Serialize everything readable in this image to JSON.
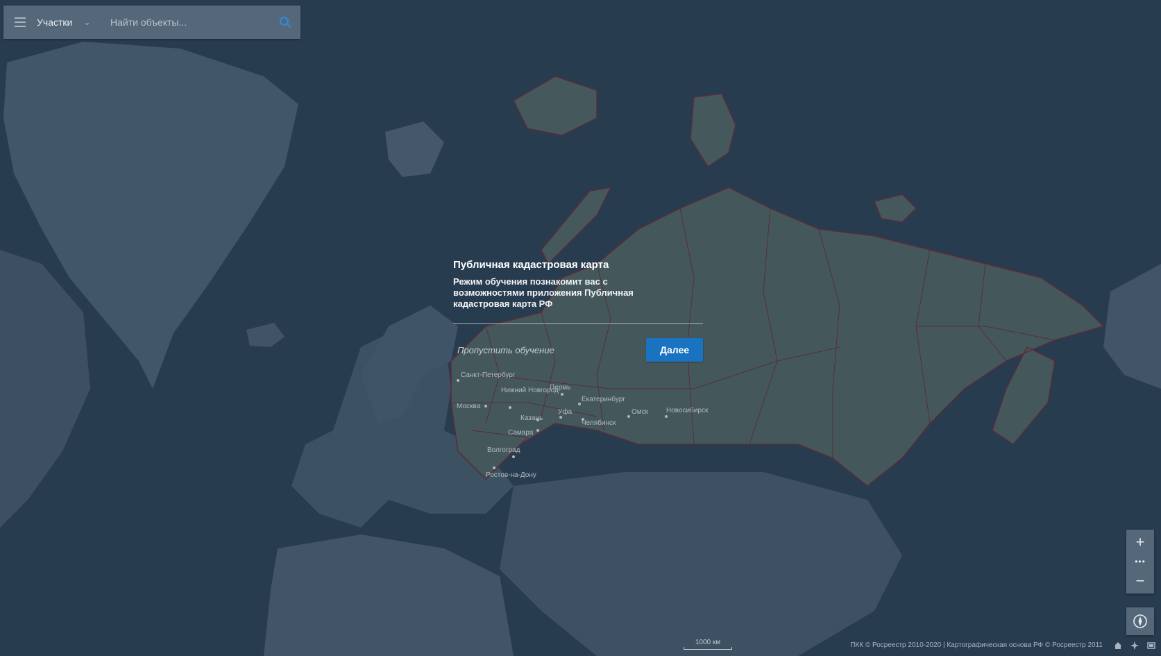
{
  "search": {
    "mode_label": "Участки",
    "placeholder": "Найти объекты..."
  },
  "tutorial": {
    "title": "Публичная кадастровая карта",
    "text": "Режим обучения познакомит вас с возможностями приложения Публичная кадастровая карта РФ",
    "skip_label": "Пропустить обучение",
    "next_label": "Далее"
  },
  "map": {
    "cities": [
      "Санкт-Петербург",
      "Нижний Новгород",
      "Москва",
      "Пермь",
      "Екатеринбург",
      "Уфа",
      "Казань",
      "Самара",
      "Челябинск",
      "Омск",
      "Новосибирск",
      "Волгоград",
      "Ростов-на-Дону"
    ],
    "scale_label": "1000 км",
    "attribution": "ПКК © Росреестр 2010-2020 | Картографическая основа РФ © Росреестр 2011"
  },
  "zoom": {
    "in_label": "+",
    "more_label": "•••",
    "out_label": "−"
  },
  "icons": {
    "menu": "menu-icon",
    "chevron": "chevron-down-icon",
    "search": "search-icon",
    "compass": "compass-icon",
    "home": "home-icon",
    "locate": "locate-icon",
    "layers": "layers-icon"
  },
  "colors": {
    "ocean": "#2e4357",
    "land": "#4a5f70",
    "russia_land": "#586c68",
    "border": "#7a2a3a",
    "accent": "#1a73c0"
  }
}
